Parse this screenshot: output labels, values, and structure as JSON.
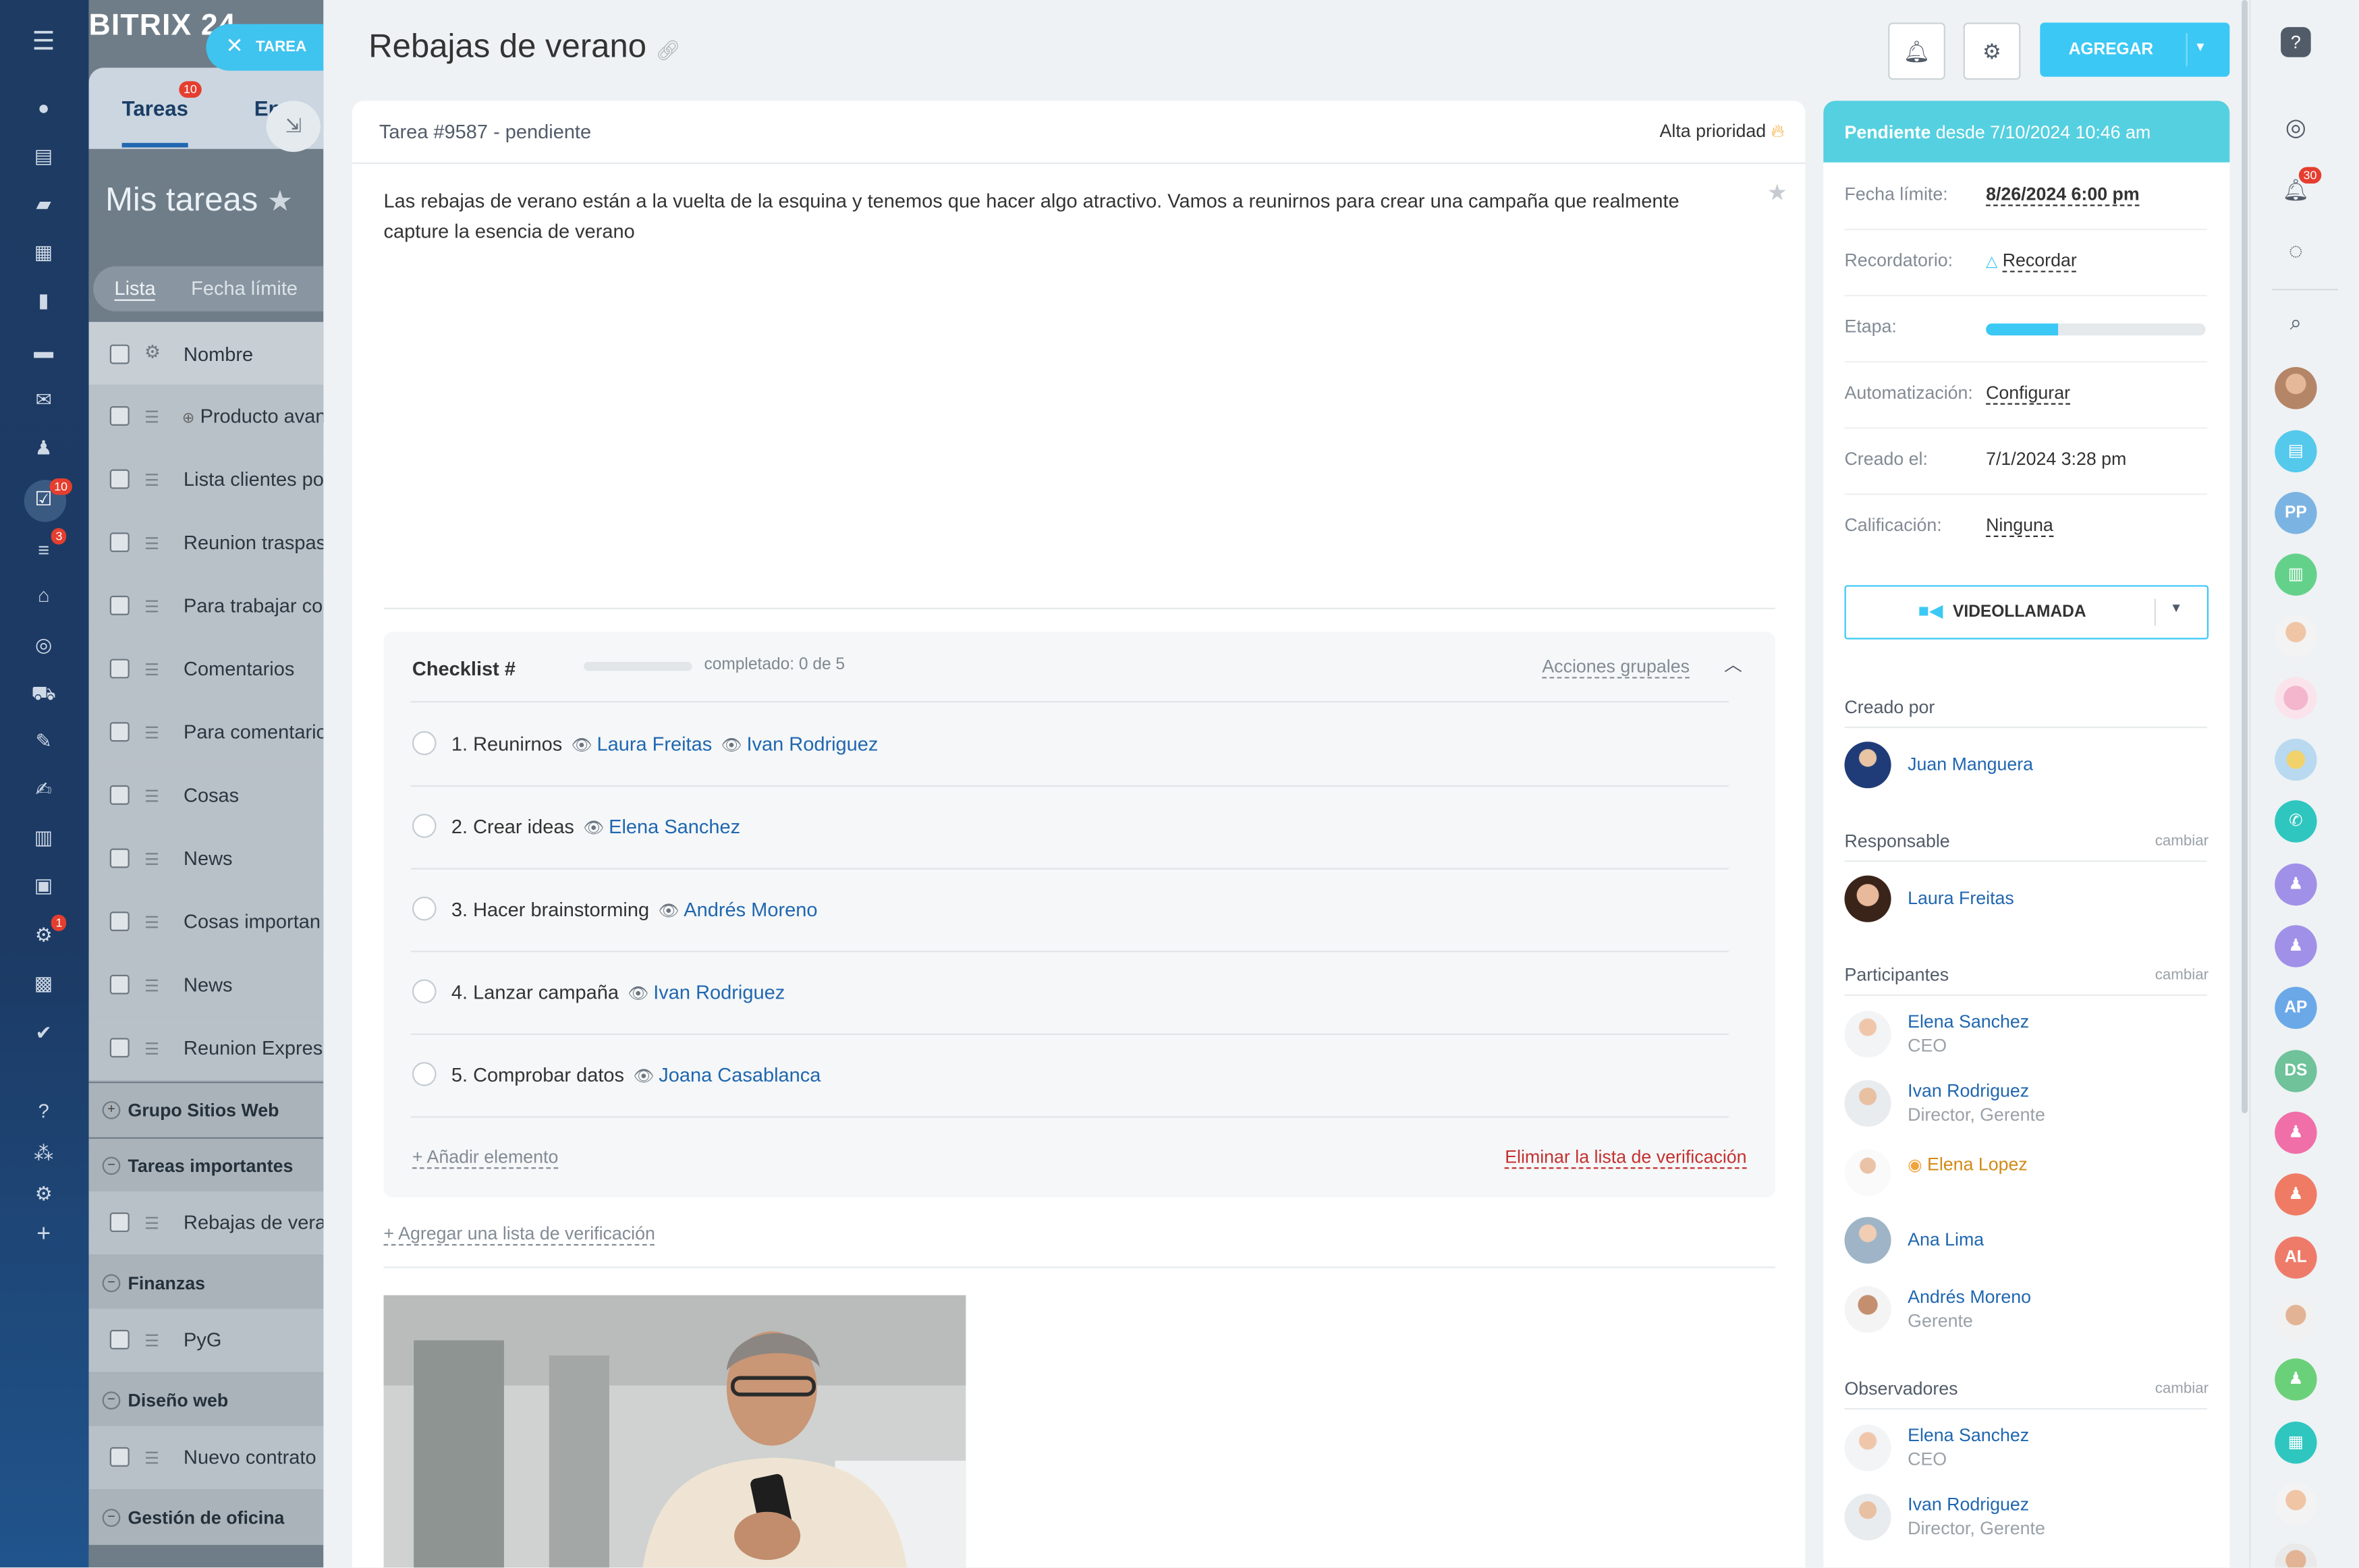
{
  "leftbar": {
    "brand": "BITRIX 24",
    "tasks_badge": "10",
    "funnel_badge": "3",
    "robot_badge": "1"
  },
  "bg": {
    "tab_tasks": "Tareas",
    "tab_tasks_badge": "10",
    "tab_other": "En",
    "my_tasks": "Mis tareas",
    "view_list": "Lista",
    "view_deadline": "Fecha límite",
    "col_name": "Nombre",
    "rows": [
      "Producto avanzado",
      "Lista clientes po",
      "Reunion traspas",
      "Para trabajar co",
      "Comentarios",
      "Para comentario",
      "Cosas",
      "News",
      "Cosas importan",
      "News",
      "Reunion Express"
    ],
    "group1": "Grupo Sitios Web",
    "group2": "Tareas importantes",
    "row_g2": "Rebajas de vera",
    "group3": "Finanzas",
    "row_g3": "PyG",
    "group4": "Diseño web",
    "row_g4": "Nuevo contrato",
    "group5": "Gestión de oficina"
  },
  "close_tab": {
    "label": "TAREA"
  },
  "header": {
    "title": "Rebajas de verano",
    "add_label": "AGREGAR"
  },
  "task": {
    "number_status": "Tarea #9587 - pendiente",
    "priority": "Alta prioridad",
    "description": "Las rebajas de verano están a la vuelta de la esquina y tenemos que hacer algo atractivo. Vamos a reunirnos para crear una campaña que realmente capture la esencia de verano"
  },
  "checklist": {
    "title": "Checklist #",
    "progress_text": "completado: 0 de 5",
    "progress": 0,
    "group_actions": "Acciones grupales",
    "items": [
      {
        "label": "1. Reunirnos",
        "people": [
          "Laura Freitas",
          "Ivan Rodriguez"
        ]
      },
      {
        "label": "2. Crear ideas",
        "people": [
          "Elena Sanchez"
        ]
      },
      {
        "label": "3. Hacer brainstorming",
        "people": [
          "Andrés Moreno"
        ]
      },
      {
        "label": "4. Lanzar campaña",
        "people": [
          "Ivan Rodriguez"
        ]
      },
      {
        "label": "5. Comprobar datos",
        "people": [
          "Joana Casablanca"
        ]
      }
    ],
    "add_item": "+ Añadir elemento",
    "delete_list": "Eliminar la lista de verificación",
    "add_list": "+ Agregar una lista de verificación"
  },
  "status_panel": {
    "status_bold": "Pendiente",
    "status_rest": " desde 7/10/2024 10:46 am",
    "rows": [
      {
        "key": "Fecha límite:",
        "value": "8/26/2024 6:00 pm"
      },
      {
        "key": "Recordatorio:",
        "value": "Recordar"
      },
      {
        "key": "Etapa:",
        "value": ""
      },
      {
        "key": "Automatización:",
        "value": "Configurar"
      },
      {
        "key": "Creado el:",
        "value": "7/1/2024 3:28 pm"
      },
      {
        "key": "Calificación:",
        "value": "Ninguna"
      }
    ],
    "stage_progress": 0.33,
    "video_call": "VIDEOLLAMADA"
  },
  "people_panel": {
    "created_by_title": "Creado por",
    "created_by": "Juan Manguera",
    "responsible_title": "Responsable",
    "change": "cambiar",
    "responsible": "Laura Freitas",
    "participants_title": "Participantes",
    "participants": [
      {
        "name": "Elena Sanchez",
        "role": "CEO"
      },
      {
        "name": "Ivan Rodriguez",
        "role": "Director, Gerente"
      },
      {
        "name": "Elena Lopez",
        "role": ""
      },
      {
        "name": "Ana Lima",
        "role": ""
      },
      {
        "name": "Andrés Moreno",
        "role": "Gerente"
      }
    ],
    "observers_title": "Observadores",
    "observers": [
      {
        "name": "Elena Sanchez",
        "role": "CEO"
      },
      {
        "name": "Ivan Rodriguez",
        "role": "Director, Gerente"
      }
    ]
  },
  "rightbar": {
    "notif_badge": "30",
    "initials": [
      "PP",
      "AP",
      "DS",
      "AL"
    ]
  },
  "colors": {
    "accent": "#3bc8f5",
    "status_head": "#55d0e0",
    "link": "#2067b0",
    "danger": "#c5302f",
    "sidebar": "#1d3b63"
  }
}
